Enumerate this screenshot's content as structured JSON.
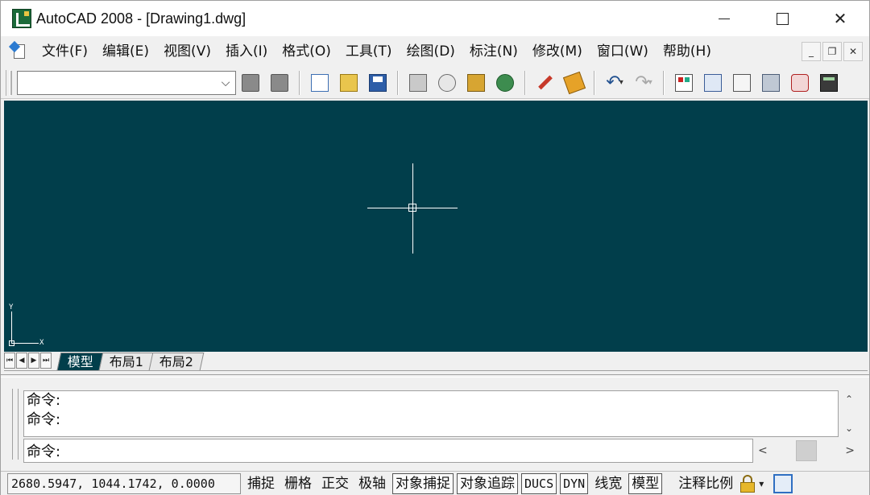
{
  "window": {
    "title": "AutoCAD 2008 - [Drawing1.dwg]",
    "controls": {
      "minimize": "minimize",
      "maximize": "maximize",
      "close": "✕"
    }
  },
  "menu": {
    "items": [
      "文件(F)",
      "编辑(E)",
      "视图(V)",
      "插入(I)",
      "格式(O)",
      "工具(T)",
      "绘图(D)",
      "标注(N)",
      "修改(M)",
      "窗口(W)",
      "帮助(H)"
    ],
    "mdi": {
      "minimize": "_",
      "restore": "❐",
      "close": "✕"
    }
  },
  "toolbar": {
    "workspace_combo_value": "",
    "combo_arrow": "⌵",
    "undo_glyph": "↶",
    "redo_glyph": "↷",
    "dropdown_glyph": "▾"
  },
  "tabs": {
    "nav": [
      "⏮",
      "◀",
      "▶",
      "⏭"
    ],
    "items": [
      {
        "label": "模型",
        "active": true
      },
      {
        "label": "布局1",
        "active": false
      },
      {
        "label": "布局2",
        "active": false
      }
    ]
  },
  "ucs": {
    "y_label": "Y",
    "x_label": "X"
  },
  "command": {
    "history": [
      "命令:",
      "命令:"
    ],
    "prompt": "命令:",
    "scroll_up": "⌃",
    "scroll_down": "⌄",
    "scroll_left": "<",
    "scroll_right": ">"
  },
  "status": {
    "coordinates": "2680.5947, 1044.1742, 0.0000",
    "buttons": [
      {
        "label": "捕捉",
        "on": false,
        "mono": false
      },
      {
        "label": "栅格",
        "on": false,
        "mono": false
      },
      {
        "label": "正交",
        "on": false,
        "mono": false
      },
      {
        "label": "极轴",
        "on": false,
        "mono": false
      },
      {
        "label": "对象捕捉",
        "on": true,
        "mono": false
      },
      {
        "label": "对象追踪",
        "on": true,
        "mono": false
      },
      {
        "label": "DUCS",
        "on": true,
        "mono": true
      },
      {
        "label": "DYN",
        "on": true,
        "mono": true
      },
      {
        "label": "线宽",
        "on": false,
        "mono": false
      },
      {
        "label": "模型",
        "on": true,
        "mono": false
      }
    ],
    "annotation_scale_label": "注释比例",
    "dropdown_glyph": "▾"
  },
  "colors": {
    "canvas_background": "#013e4b",
    "crosshair": "#ffffff",
    "chrome": "#f0f0f0"
  }
}
